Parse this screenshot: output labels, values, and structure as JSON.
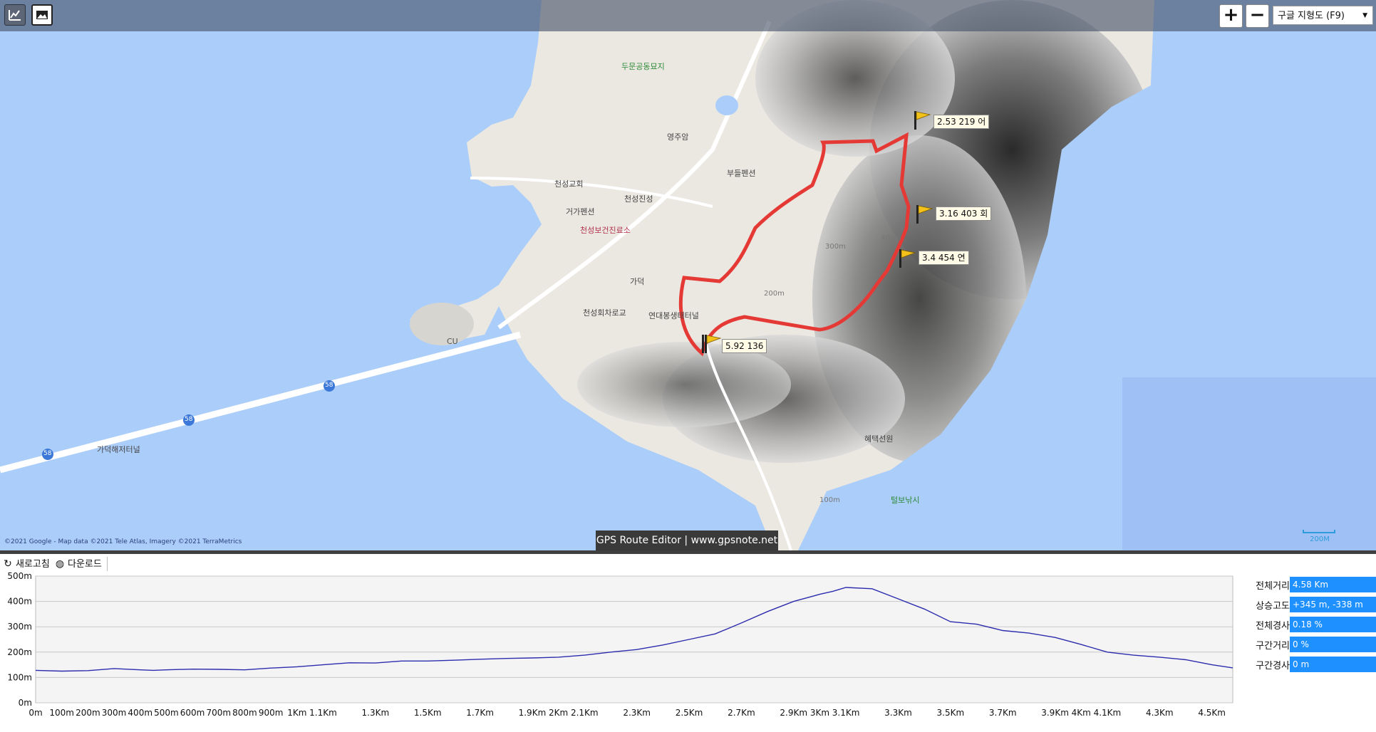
{
  "map": {
    "map_type": "구글 지형도 (F9)",
    "copyright": "©2021 Google - Map data ©2021 Tele Atlas, Imagery ©2021 TerraMetrics",
    "brand": "GPS Route Editor | www.gpsnote.net",
    "scale_label": "200M",
    "zoom_in": "+",
    "zoom_out": "−",
    "labels": [
      "두문공동묘지",
      "영주암",
      "천성교회",
      "천성진성",
      "부들펜션",
      "거가펜션",
      "천성보건진료소",
      "가덕",
      "천성회차로교",
      "연대봉생태터널",
      "CU",
      "가덕해저터널",
      "혜택선원",
      "털보낚시",
      "58",
      "58",
      "58",
      "100m",
      "200m",
      "300m",
      "400m"
    ],
    "waypoints": [
      {
        "label": "2.53 219 어"
      },
      {
        "label": "3.16 403 회"
      },
      {
        "label": "3.4 454 연"
      },
      {
        "label": "5.92 136"
      }
    ],
    "colors": {
      "sea": "#abcdfa",
      "route": "#e53935",
      "flag": "#f3c21a"
    }
  },
  "toolbar": {
    "refresh": "새로고침",
    "download": "다운로드",
    "refresh_icon": "refresh-icon",
    "download_icon": "globe-icon"
  },
  "stats": [
    {
      "label": "전체거리",
      "value": "4.58 Km"
    },
    {
      "label": "상승고도",
      "value": "+345 m, -338 m"
    },
    {
      "label": "전체경사",
      "value": "0.18 %"
    },
    {
      "label": "구간거리",
      "value": "0 %"
    },
    {
      "label": "구간경사",
      "value": "0 m"
    }
  ],
  "chart_data": {
    "type": "line",
    "xlabel": "",
    "ylabel": "",
    "ylim": [
      0,
      500
    ],
    "xlim": [
      0,
      4.58
    ],
    "y_ticks": [
      "500m",
      "400m",
      "300m",
      "200m",
      "100m",
      "0m"
    ],
    "x_ticks": [
      "0m",
      "100m",
      "200m",
      "300m",
      "400m",
      "500m",
      "600m",
      "700m",
      "800m",
      "900m",
      "1Km",
      "1.1Km",
      "1.3Km",
      "1.5Km",
      "1.7Km",
      "1.9Km",
      "2Km",
      "2.1Km",
      "2.3Km",
      "2.5Km",
      "2.7Km",
      "2.9Km",
      "3Km",
      "3.1Km",
      "3.3Km",
      "3.5Km",
      "3.7Km",
      "3.9Km",
      "4Km",
      "4.1Km",
      "4.3Km",
      "4.5Km"
    ],
    "x_tick_values": [
      0,
      0.1,
      0.2,
      0.3,
      0.4,
      0.5,
      0.6,
      0.7,
      0.8,
      0.9,
      1.0,
      1.1,
      1.3,
      1.5,
      1.7,
      1.9,
      2.0,
      2.1,
      2.3,
      2.5,
      2.7,
      2.9,
      3.0,
      3.1,
      3.3,
      3.5,
      3.7,
      3.9,
      4.0,
      4.1,
      4.3,
      4.5
    ],
    "grid": true,
    "series": [
      {
        "x": [
          0,
          0.1,
          0.2,
          0.3,
          0.4,
          0.45,
          0.5,
          0.6,
          0.7,
          0.8,
          0.9,
          1.0,
          1.1,
          1.2,
          1.3,
          1.4,
          1.5,
          1.6,
          1.7,
          1.8,
          1.9,
          2.0,
          2.1,
          2.2,
          2.3,
          2.4,
          2.5,
          2.6,
          2.7,
          2.8,
          2.9,
          3.0,
          3.05,
          3.1,
          3.2,
          3.3,
          3.4,
          3.5,
          3.6,
          3.7,
          3.8,
          3.9,
          4.0,
          4.1,
          4.2,
          4.3,
          4.4,
          4.5,
          4.58
        ],
        "y": [
          128,
          125,
          127,
          135,
          130,
          128,
          130,
          133,
          132,
          130,
          137,
          142,
          150,
          158,
          157,
          165,
          165,
          168,
          172,
          175,
          177,
          180,
          188,
          200,
          210,
          228,
          250,
          272,
          315,
          360,
          400,
          428,
          440,
          455,
          450,
          410,
          370,
          320,
          310,
          285,
          275,
          258,
          230,
          200,
          188,
          180,
          170,
          150,
          138
        ]
      }
    ],
    "colors": {
      "line": "#2c2cae",
      "plot_bg": "#f4f4f4",
      "grid": "#c8c8c8"
    }
  }
}
